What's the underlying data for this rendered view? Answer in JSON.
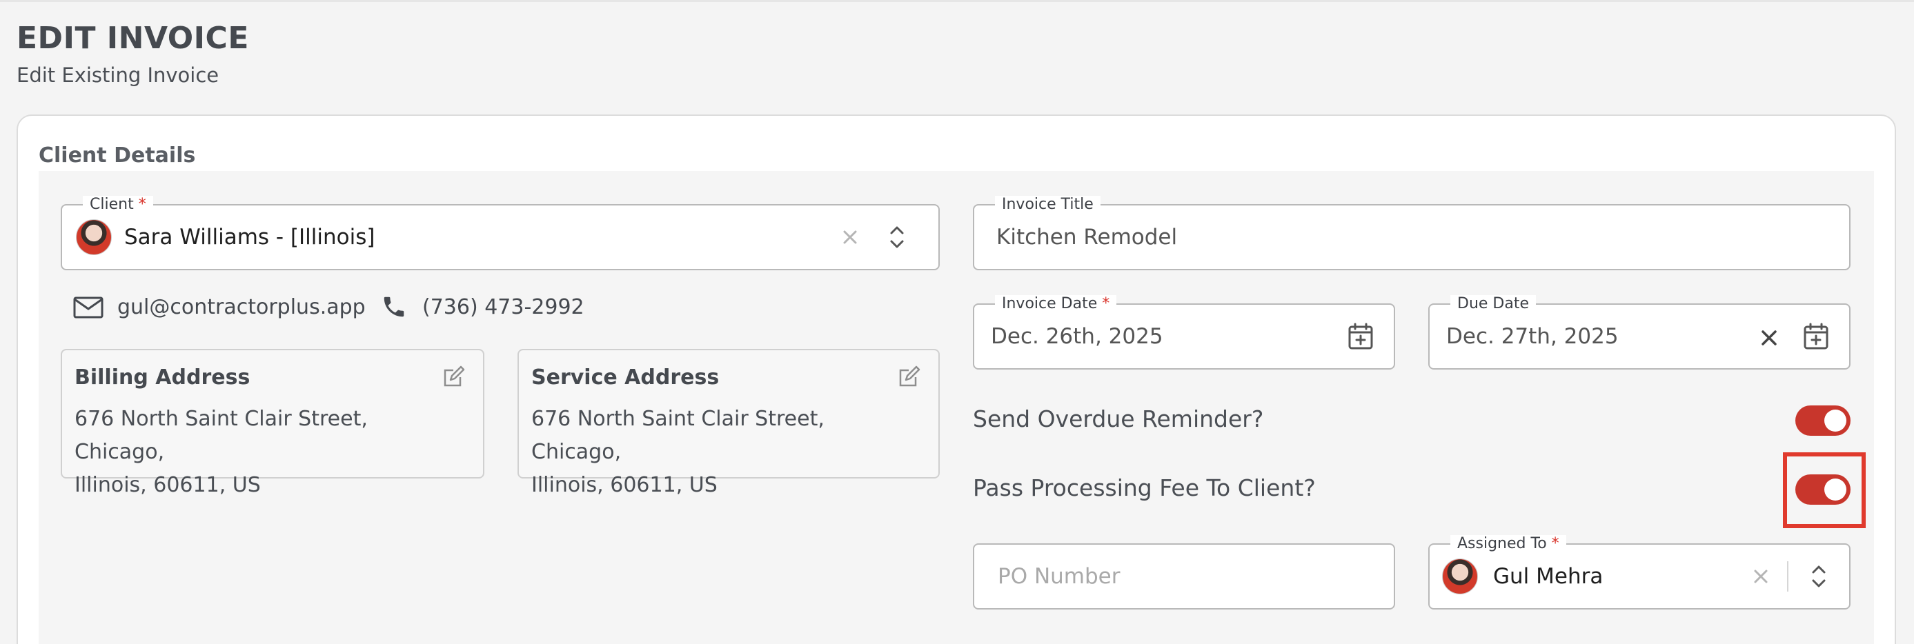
{
  "header": {
    "title": "EDIT INVOICE",
    "subtitle": "Edit Existing Invoice"
  },
  "section": {
    "title": "Client Details"
  },
  "client": {
    "label": "Client",
    "required_mark": "*",
    "value": "Sara Williams - [Illinois]",
    "email": "gul@contractorplus.app",
    "phone": "(736) 473-2992"
  },
  "billing": {
    "title": "Billing Address",
    "line1": "676 North Saint Clair Street, Chicago,",
    "line2": "Illinois, 60611, US"
  },
  "service": {
    "title": "Service Address",
    "line1": "676 North Saint Clair Street, Chicago,",
    "line2": "Illinois, 60611, US"
  },
  "invoice_title": {
    "label": "Invoice Title",
    "value": "Kitchen Remodel"
  },
  "invoice_date": {
    "label": "Invoice Date",
    "required_mark": "*",
    "value": "Dec. 26th, 2025"
  },
  "due_date": {
    "label": "Due Date",
    "value": "Dec. 27th, 2025"
  },
  "toggles": {
    "overdue_label": "Send Overdue Reminder?",
    "overdue_on": true,
    "fee_label": "Pass Processing Fee To Client?",
    "fee_on": true
  },
  "po_number": {
    "placeholder": "PO Number"
  },
  "assigned_to": {
    "label": "Assigned To",
    "required_mark": "*",
    "value": "Gul Mehra"
  },
  "colors": {
    "accent": "#c8362c",
    "highlight": "#e03a2d"
  }
}
